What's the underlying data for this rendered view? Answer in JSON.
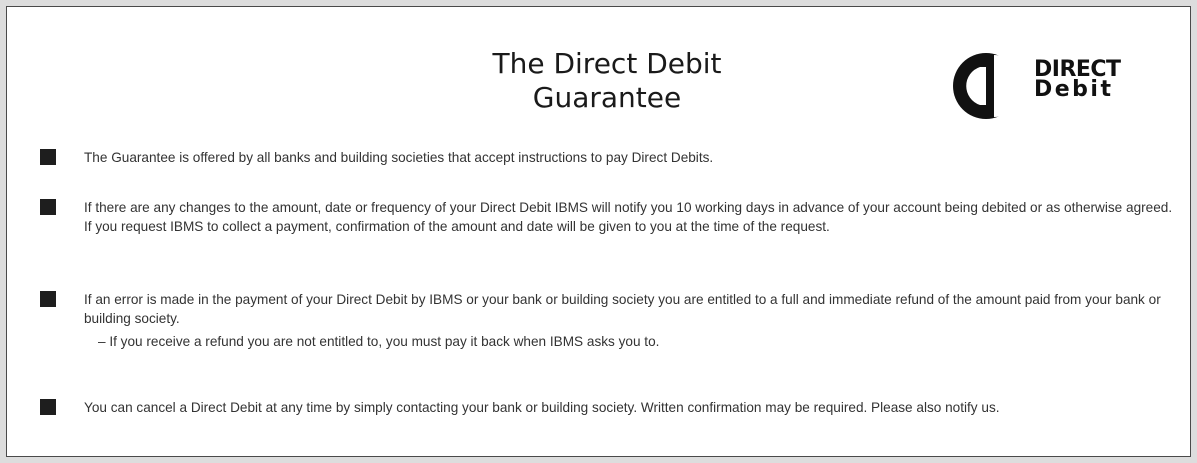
{
  "header": {
    "title_line1": "The Direct Debit",
    "title_line2": "Guarantee",
    "logo_line1": "DIRECT",
    "logo_line2": "Debit"
  },
  "guarantee": {
    "items": [
      {
        "text": "The Guarantee is offered by all banks and building societies that accept instructions to pay Direct Debits."
      },
      {
        "text": "If there are any changes to the amount, date or frequency of your Direct Debit IBMS will notify you 10 working days in advance of your account being debited or as otherwise agreed. If you request IBMS to collect a payment, confirmation of the amount and date will be given to you at the time of the request."
      },
      {
        "text": "If an error is made in the payment of your Direct Debit by IBMS or your bank or building society you are entitled to a full and immediate refund of the amount paid from your bank or building society.",
        "sub": "– If you receive a refund you are not entitled to, you must pay it back when IBMS asks you to."
      },
      {
        "text": "You can cancel a Direct Debit at any time by simply contacting your bank or building society. Written confirmation may be required. Please also notify us."
      }
    ]
  },
  "colors": {
    "border": "#4a4a4a",
    "bullet": "#1e1e1e",
    "text": "#333333"
  }
}
